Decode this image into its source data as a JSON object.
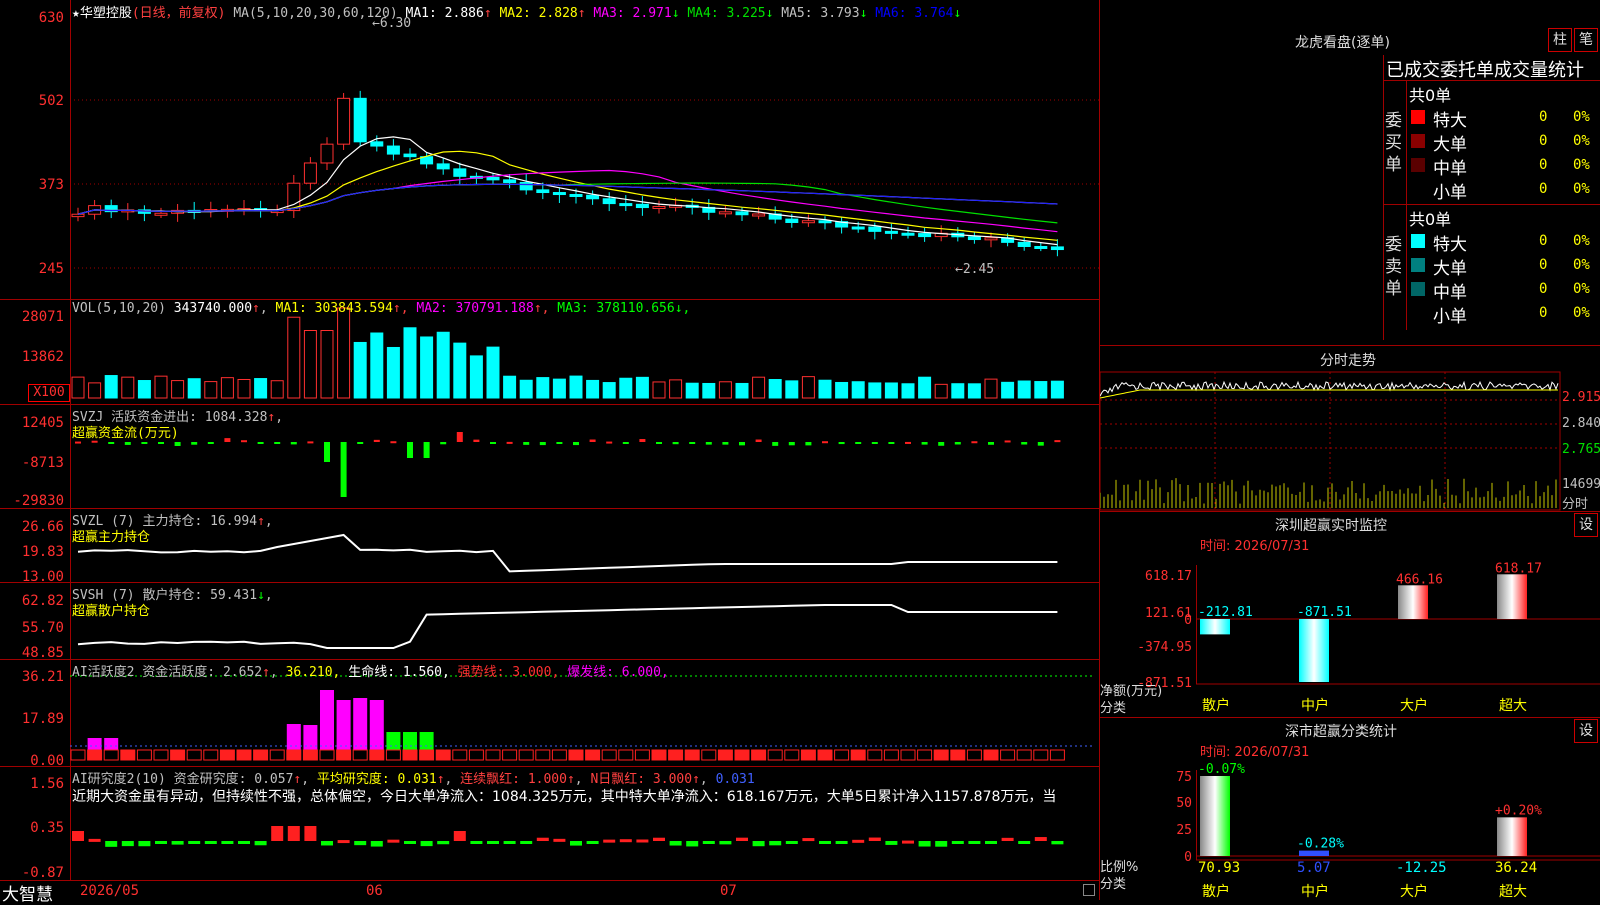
{
  "stock": {
    "name": "华塑控股",
    "mode": "(日线，前复权)",
    "ma_header": "MA(5,10,20,30,60,120)",
    "ma": [
      {
        "label": "MA1:",
        "value": "2.886",
        "arrow": "↑",
        "color": "#ffffff"
      },
      {
        "label": "MA2:",
        "value": "2.828",
        "arrow": "↑",
        "color": "#ffff00"
      },
      {
        "label": "MA3:",
        "value": "2.971",
        "arrow": "↓",
        "color": "#ff00ff"
      },
      {
        "label": "MA4:",
        "value": "3.225",
        "arrow": "↓",
        "color": "#00e000"
      },
      {
        "label": "MA5:",
        "value": "3.793",
        "arrow": "↓",
        "color": "#c0c0c0"
      },
      {
        "label": "MA6:",
        "value": "3.764",
        "arrow": "↓",
        "color": "#0000ff"
      }
    ],
    "high_label": "6.30",
    "low_label": "←2.45"
  },
  "price_axis": [
    "630",
    "502",
    "373",
    "245"
  ],
  "vol": {
    "header": "VOL(5,10,20)",
    "value": "343740.000",
    "ma": [
      {
        "label": "MA1:",
        "value": "303843.594",
        "color": "#ffff00"
      },
      {
        "label": "MA2:",
        "value": "370791.188",
        "color": "#ff00ff"
      },
      {
        "label": "MA3:",
        "value": "378110.656",
        "color": "#00ff00"
      }
    ],
    "axis": [
      "28071",
      "13862"
    ],
    "unit": "X100"
  },
  "svzj": {
    "header": "SVZJ  活跃资金进出: 1084.328",
    "sub": "超赢资金流(万元)",
    "axis": [
      "12405",
      "-8713",
      "-29830"
    ]
  },
  "svzl": {
    "header": "SVZL (7) 主力持仓: 16.994",
    "sub": "超赢主力持仓",
    "axis": [
      "26.66",
      "19.83",
      "13.00"
    ]
  },
  "svsh": {
    "header": "SVSH (7) 散户持仓: 59.431",
    "sub": "超赢散户持仓",
    "axis": [
      "62.82",
      "55.70",
      "48.85"
    ]
  },
  "ai": {
    "header": "AI活跃度2 资金活跃度: 2.652",
    "v2": "36.210,",
    "v3": "生命线: 1.560,",
    "v4": "强势线: 3.000,",
    "v5": "爆发线: 6.000,",
    "axis": [
      "36.21",
      "17.89",
      "0.00"
    ]
  },
  "ai2": {
    "header": "AI研究度2(10) 资金研究度: 0.057",
    "avg": "平均研究度: 0.031",
    "lianxu": "连续飘红: 1.000",
    "nday": "N日飘红: 3.000",
    "last": "0.031",
    "axis": [
      "1.56",
      "0.35",
      "-0.87"
    ],
    "comment": "近期大资金虽有异动，但持续性不强，总体偏空，今日大单净流入：1084.325万元，其中特大单净流入：618.167万元，大单5日累计净入1157.878万元，当"
  },
  "bottom": {
    "brand": "大智慧",
    "dates": [
      "2026/05",
      "06",
      "07"
    ]
  },
  "lhb": {
    "title": "龙虎看盘(逐单)",
    "btn1": "柱",
    "btn2": "笔",
    "subtitle": "已成交委托单成交量统计",
    "buy": {
      "side": "委买单",
      "total": "共0单",
      "rows": [
        {
          "name": "特大",
          "n": "0",
          "p": "0%",
          "color": "#ff0000"
        },
        {
          "name": "大单",
          "n": "0",
          "p": "0%",
          "color": "#8b0000"
        },
        {
          "name": "中单",
          "n": "0",
          "p": "0%",
          "color": "#5a0000"
        },
        {
          "name": "小单",
          "n": "0",
          "p": "0%",
          "color": ""
        }
      ]
    },
    "sell": {
      "side": "委卖单",
      "total": "共0单",
      "rows": [
        {
          "name": "特大",
          "n": "0",
          "p": "0%",
          "color": "#00ffff"
        },
        {
          "name": "大单",
          "n": "0",
          "p": "0%",
          "color": "#008080"
        },
        {
          "name": "中单",
          "n": "0",
          "p": "0%",
          "color": "#006666"
        },
        {
          "name": "小单",
          "n": "0",
          "p": "0%",
          "color": ""
        }
      ]
    }
  },
  "intraday": {
    "title": "分时走势",
    "axis": [
      "2.915",
      "2.840",
      "2.765"
    ],
    "vol": "14699",
    "unit": "分时"
  },
  "monitor": {
    "title": "深圳超赢实时监控",
    "btn": "设",
    "time": "时间: 2026/07/31",
    "axis": [
      "618.17",
      "121.61",
      "0",
      "-374.95",
      "-871.51"
    ],
    "ylabel": "净额(万元)",
    "xlabel": "分类",
    "cats": [
      "散户",
      "中户",
      "大户",
      "超大"
    ],
    "bar_labels": [
      "-212.81",
      "-871.51",
      "466.16",
      "618.17"
    ],
    "values": [
      -212.81,
      -871.51,
      466.16,
      618.17
    ]
  },
  "stat": {
    "title": "深市超赢分类统计",
    "btn": "设",
    "time": "时间: 2026/07/31",
    "axis": [
      "75",
      "50",
      "25",
      "0"
    ],
    "ylabel": "比例%",
    "xlabel": "分类",
    "cats": [
      "散户",
      "中户",
      "大户",
      "超大"
    ],
    "bot": [
      "70.93",
      "5.07",
      "-12.25",
      "36.24"
    ],
    "top": [
      "-0.07%",
      "-0.28%",
      "",
      "+0.20%"
    ]
  }
}
